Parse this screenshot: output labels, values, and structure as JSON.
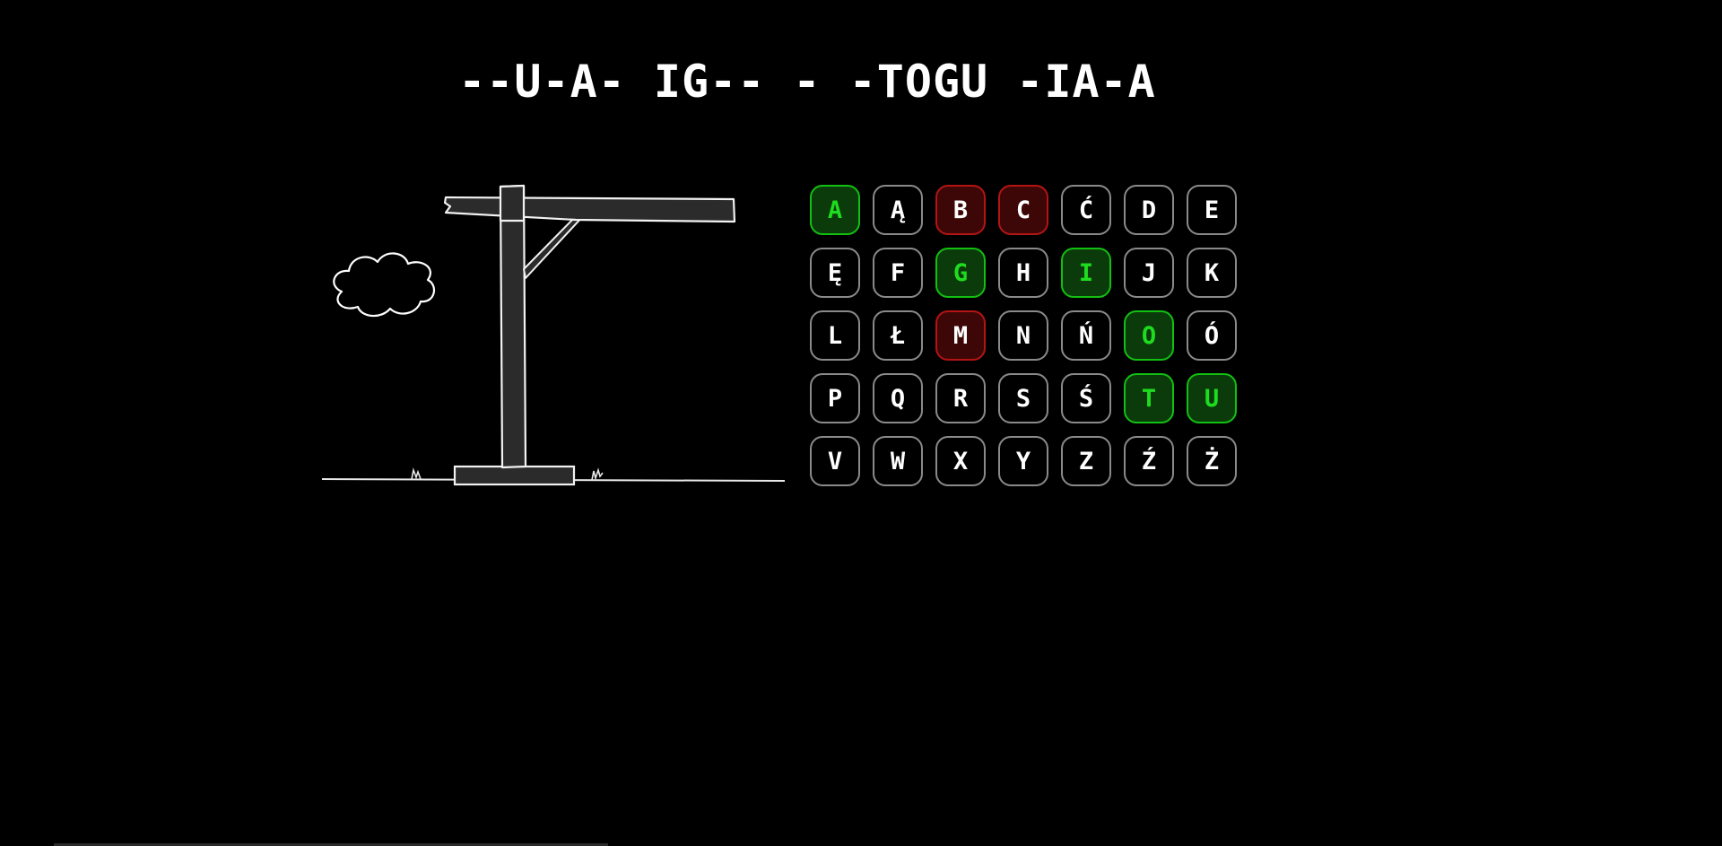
{
  "puzzle": {
    "text": "--U-A- IG-- - -TOGU -IA-A"
  },
  "keyboard": {
    "keys": [
      {
        "letter": "A",
        "state": "correct"
      },
      {
        "letter": "Ą",
        "state": "unused"
      },
      {
        "letter": "B",
        "state": "wrong"
      },
      {
        "letter": "C",
        "state": "wrong"
      },
      {
        "letter": "Ć",
        "state": "unused"
      },
      {
        "letter": "D",
        "state": "unused"
      },
      {
        "letter": "E",
        "state": "unused"
      },
      {
        "letter": "Ę",
        "state": "unused"
      },
      {
        "letter": "F",
        "state": "unused"
      },
      {
        "letter": "G",
        "state": "correct"
      },
      {
        "letter": "H",
        "state": "unused"
      },
      {
        "letter": "I",
        "state": "correct"
      },
      {
        "letter": "J",
        "state": "unused"
      },
      {
        "letter": "K",
        "state": "unused"
      },
      {
        "letter": "L",
        "state": "unused"
      },
      {
        "letter": "Ł",
        "state": "unused"
      },
      {
        "letter": "M",
        "state": "wrong"
      },
      {
        "letter": "N",
        "state": "unused"
      },
      {
        "letter": "Ń",
        "state": "unused"
      },
      {
        "letter": "O",
        "state": "correct"
      },
      {
        "letter": "Ó",
        "state": "unused"
      },
      {
        "letter": "P",
        "state": "unused"
      },
      {
        "letter": "Q",
        "state": "unused"
      },
      {
        "letter": "R",
        "state": "unused"
      },
      {
        "letter": "S",
        "state": "unused"
      },
      {
        "letter": "Ś",
        "state": "unused"
      },
      {
        "letter": "T",
        "state": "correct"
      },
      {
        "letter": "U",
        "state": "correct"
      },
      {
        "letter": "V",
        "state": "unused"
      },
      {
        "letter": "W",
        "state": "unused"
      },
      {
        "letter": "X",
        "state": "unused"
      },
      {
        "letter": "Y",
        "state": "unused"
      },
      {
        "letter": "Z",
        "state": "unused"
      },
      {
        "letter": "Ź",
        "state": "unused"
      },
      {
        "letter": "Ż",
        "state": "unused"
      }
    ]
  },
  "colors": {
    "background": "#000000",
    "correct": "#1edc1e",
    "wrong": "#b41414",
    "neutral_border": "#8a8a8a",
    "text": "#ffffff"
  }
}
